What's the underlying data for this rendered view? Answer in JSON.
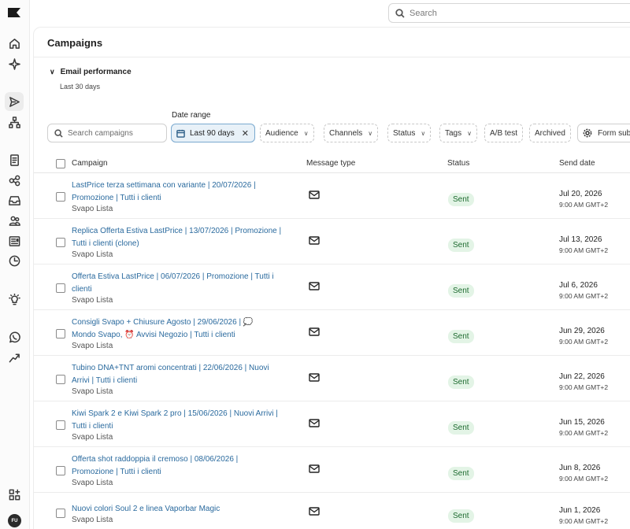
{
  "topbar": {
    "search_placeholder": "Search"
  },
  "page": {
    "title": "Campaigns"
  },
  "performance": {
    "label": "Email performance",
    "subtitle": "Last 30 days"
  },
  "filters": {
    "date_range_label": "Date range",
    "search_placeholder": "Search campaigns",
    "date_value": "Last 90 days",
    "audience": "Audience",
    "channels": "Channels",
    "status": "Status",
    "tags": "Tags",
    "ab_test": "A/B test",
    "archived": "Archived",
    "form_submit": "Form sub"
  },
  "table": {
    "headers": {
      "campaign": "Campaign",
      "message_type": "Message type",
      "status": "Status",
      "send_date": "Send date"
    },
    "rows": [
      {
        "line1": "LastPrice terza settimana con variante | 20/07/2026 |",
        "line2": "Promozione | Tutti i clienti",
        "list": "Svapo Lista",
        "status": "Sent",
        "date": "Jul 20, 2026",
        "time": "9:00 AM GMT+2"
      },
      {
        "line1": "Replica Offerta Estiva LastPrice | 13/07/2026 | Promozione |",
        "line2": "Tutti i clienti (clone)",
        "list": "Svapo Lista",
        "status": "Sent",
        "date": "Jul 13, 2026",
        "time": "9:00 AM GMT+2"
      },
      {
        "line1": "Offerta Estiva LastPrice | 06/07/2026 | Promozione | Tutti i",
        "line2": "clienti",
        "list": "Svapo Lista",
        "status": "Sent",
        "date": "Jul 6, 2026",
        "time": "9:00 AM GMT+2"
      },
      {
        "line1": "Consigli Svapo + Chiusure Agosto | 29/06/2026 | 💭",
        "line2": "Mondo Svapo, ⏰ Avvisi Negozio | Tutti i clienti",
        "list": "Svapo Lista",
        "status": "Sent",
        "date": "Jun 29, 2026",
        "time": "9:00 AM GMT+2"
      },
      {
        "line1": "Tubino DNA+TNT aromi concentrati | 22/06/2026 | Nuovi",
        "line2": "Arrivi | Tutti i clienti",
        "list": "Svapo Lista",
        "status": "Sent",
        "date": "Jun 22, 2026",
        "time": "9:00 AM GMT+2"
      },
      {
        "line1": "Kiwi Spark 2 e Kiwi Spark 2 pro | 15/06/2026 | Nuovi Arrivi |",
        "line2": "Tutti i clienti",
        "list": "Svapo Lista",
        "status": "Sent",
        "date": "Jun 15, 2026",
        "time": "9:00 AM GMT+2"
      },
      {
        "line1": "Offerta shot raddoppia il cremoso | 08/06/2026 |",
        "line2": "Promozione | Tutti i clienti",
        "list": "Svapo Lista",
        "status": "Sent",
        "date": "Jun 8, 2026",
        "time": "9:00 AM GMT+2"
      },
      {
        "line1": "Nuovi colori Soul 2 e linea Vaporbar Magic",
        "line2": "",
        "list": "Svapo Lista",
        "status": "Sent",
        "date": "Jun 1, 2026",
        "time": "9:00 AM GMT+2"
      }
    ]
  },
  "user": {
    "initials": "FU"
  },
  "colors": {
    "link": "#2a6a9e",
    "sent_bg": "#e3f4e6",
    "sent_text": "#1e6b30",
    "selected_filter_bg": "#e8f1f8"
  }
}
